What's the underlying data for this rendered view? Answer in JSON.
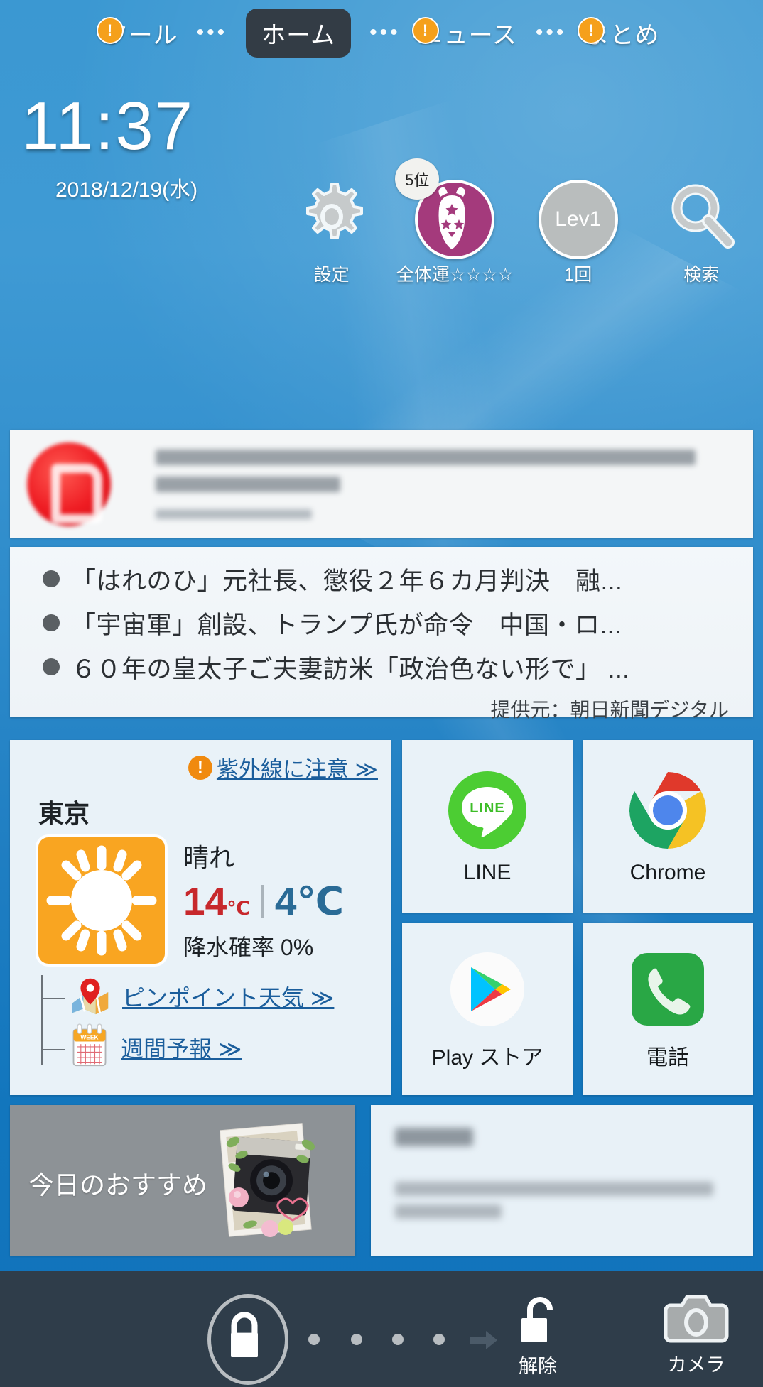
{
  "topnav": {
    "items": [
      {
        "label": "ツール",
        "active": false,
        "alert": true
      },
      {
        "label": "ホーム",
        "active": true,
        "alert": false
      },
      {
        "label": "ニュース",
        "active": false,
        "alert": true
      },
      {
        "label": "まとめ",
        "active": false,
        "alert": true
      }
    ],
    "separator": "•••"
  },
  "clock": {
    "time": "11:37",
    "date": "2018/12/19(水)"
  },
  "widgets": [
    {
      "name": "settings",
      "label": "設定",
      "icon": "gear-icon",
      "badge": ""
    },
    {
      "name": "horoscope",
      "label": "全体運☆☆☆☆",
      "icon": "zodiac-taurus-icon",
      "badge": "5位"
    },
    {
      "name": "level",
      "label": "1回",
      "icon": "level-badge-icon",
      "badge": "",
      "value": "Lev1"
    },
    {
      "name": "search",
      "label": "検索",
      "icon": "search-icon",
      "badge": ""
    }
  ],
  "ad": {
    "label": "advertisement-banner",
    "logo_alt": "red-circular-logo"
  },
  "news": {
    "headlines": [
      "「はれのひ」元社長、懲役２年６カ月判決　融...",
      "「宇宙軍」創設、トランプ氏が命令　中国・ロ...",
      "６０年の皇太子ご夫妻訪米「政治色ない形で」 ..."
    ],
    "source": "提供元：朝日新聞デジタル"
  },
  "weather": {
    "uv_alert": "紫外線に注意 ≫",
    "city": "東京",
    "condition": "晴れ",
    "high": "14",
    "low": "4",
    "unit": "℃",
    "rain": "降水確率 0%",
    "links": [
      {
        "label": "ピンポイント天気 ≫",
        "icon": "map-pin-icon"
      },
      {
        "label": "週間予報 ≫",
        "icon": "calendar-week-icon"
      }
    ]
  },
  "apps": [
    {
      "name": "LINE",
      "icon": "line-icon"
    },
    {
      "name": "Chrome",
      "icon": "chrome-icon"
    },
    {
      "name": "Play ストア",
      "icon": "play-store-icon"
    },
    {
      "name": "電話",
      "icon": "phone-icon"
    }
  ],
  "recommend": {
    "title": "今日のおすすめ",
    "image_alt": "camera-photo-collage"
  },
  "bottombar": {
    "lock_icon": "lock-closed-icon",
    "unlock_label": "解除",
    "unlock_icon": "lock-open-icon",
    "camera_label": "カメラ",
    "camera_icon": "camera-icon",
    "slider_dots": 4
  },
  "colors": {
    "wallpaper": "#2a8fd0",
    "nav_active_bg": "#333c45",
    "alert_orange": "#f5a01b",
    "temp_high": "#c7282c",
    "temp_low": "#2a6b96",
    "link_blue": "#1b5e9c",
    "bottombar": "#2f3d4a"
  }
}
